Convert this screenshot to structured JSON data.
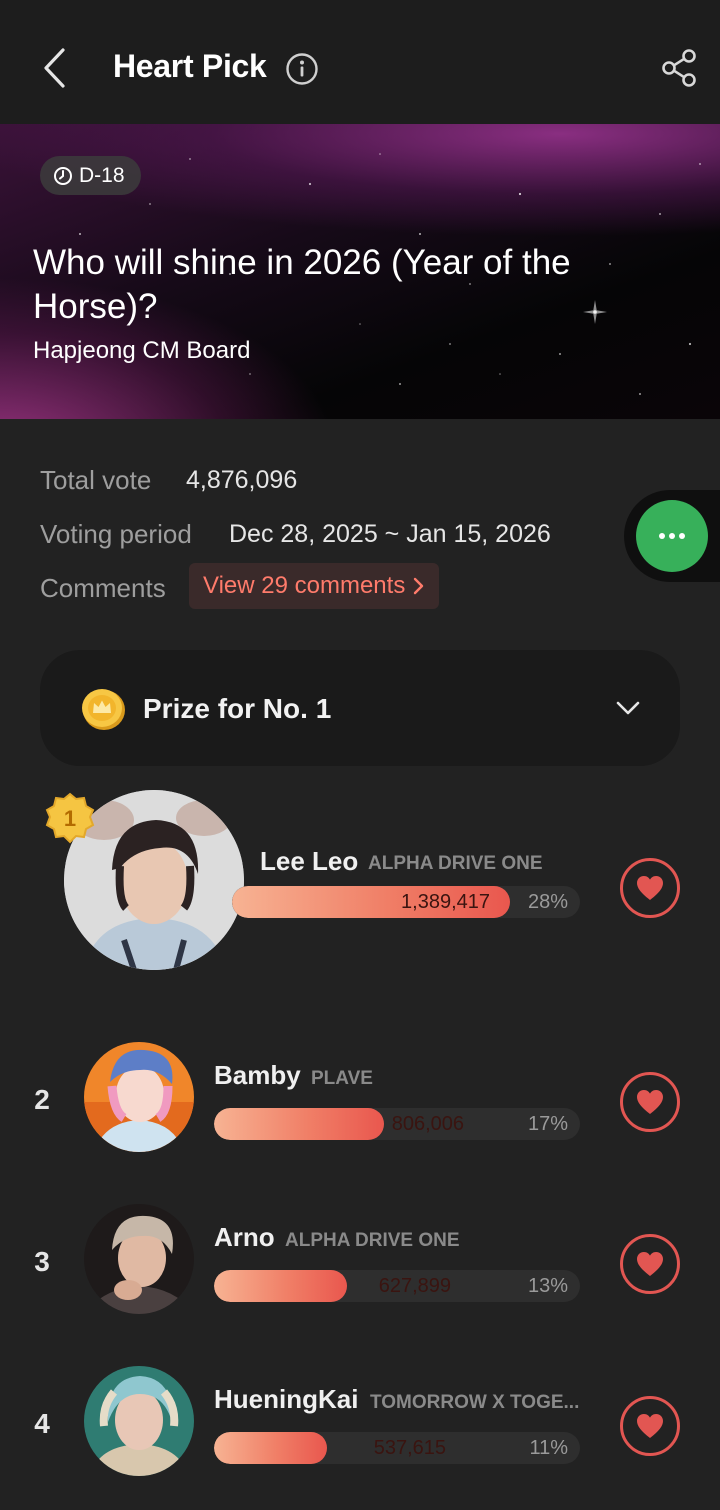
{
  "header": {
    "title": "Heart Pick"
  },
  "banner": {
    "dday": "D-18",
    "title": "Who will shine in 2026 (Year of the Horse)?",
    "subtitle": "Hapjeong CM Board"
  },
  "stats": {
    "total_vote_label": "Total vote",
    "total_vote_value": "4,876,096",
    "period_label": "Voting period",
    "period_value": "Dec 28, 2025 ~ Jan 15, 2026",
    "comments_label": "Comments",
    "comments_button": "View 29 comments"
  },
  "prize": {
    "label": "Prize for No. 1"
  },
  "ranking": [
    {
      "rank": "1",
      "name": "Lee Leo",
      "group": "ALPHA DRIVE ONE",
      "votes": "1,389,417",
      "percent": "28%",
      "share": 0.285
    },
    {
      "rank": "2",
      "name": "Bamby",
      "group": "PLAVE",
      "votes": "806,006",
      "percent": "17%",
      "share": 0.165
    },
    {
      "rank": "3",
      "name": "Arno",
      "group": "ALPHA DRIVE ONE",
      "votes": "627,899",
      "percent": "13%",
      "share": 0.129
    },
    {
      "rank": "4",
      "name": "HueningKai",
      "group": "TOMORROW X TOGE...",
      "votes": "537,615",
      "percent": "11%",
      "share": 0.11
    }
  ],
  "colors": {
    "accent": "#e25652",
    "float_button": "#37b05a",
    "comments_text": "#ff7b6b"
  }
}
